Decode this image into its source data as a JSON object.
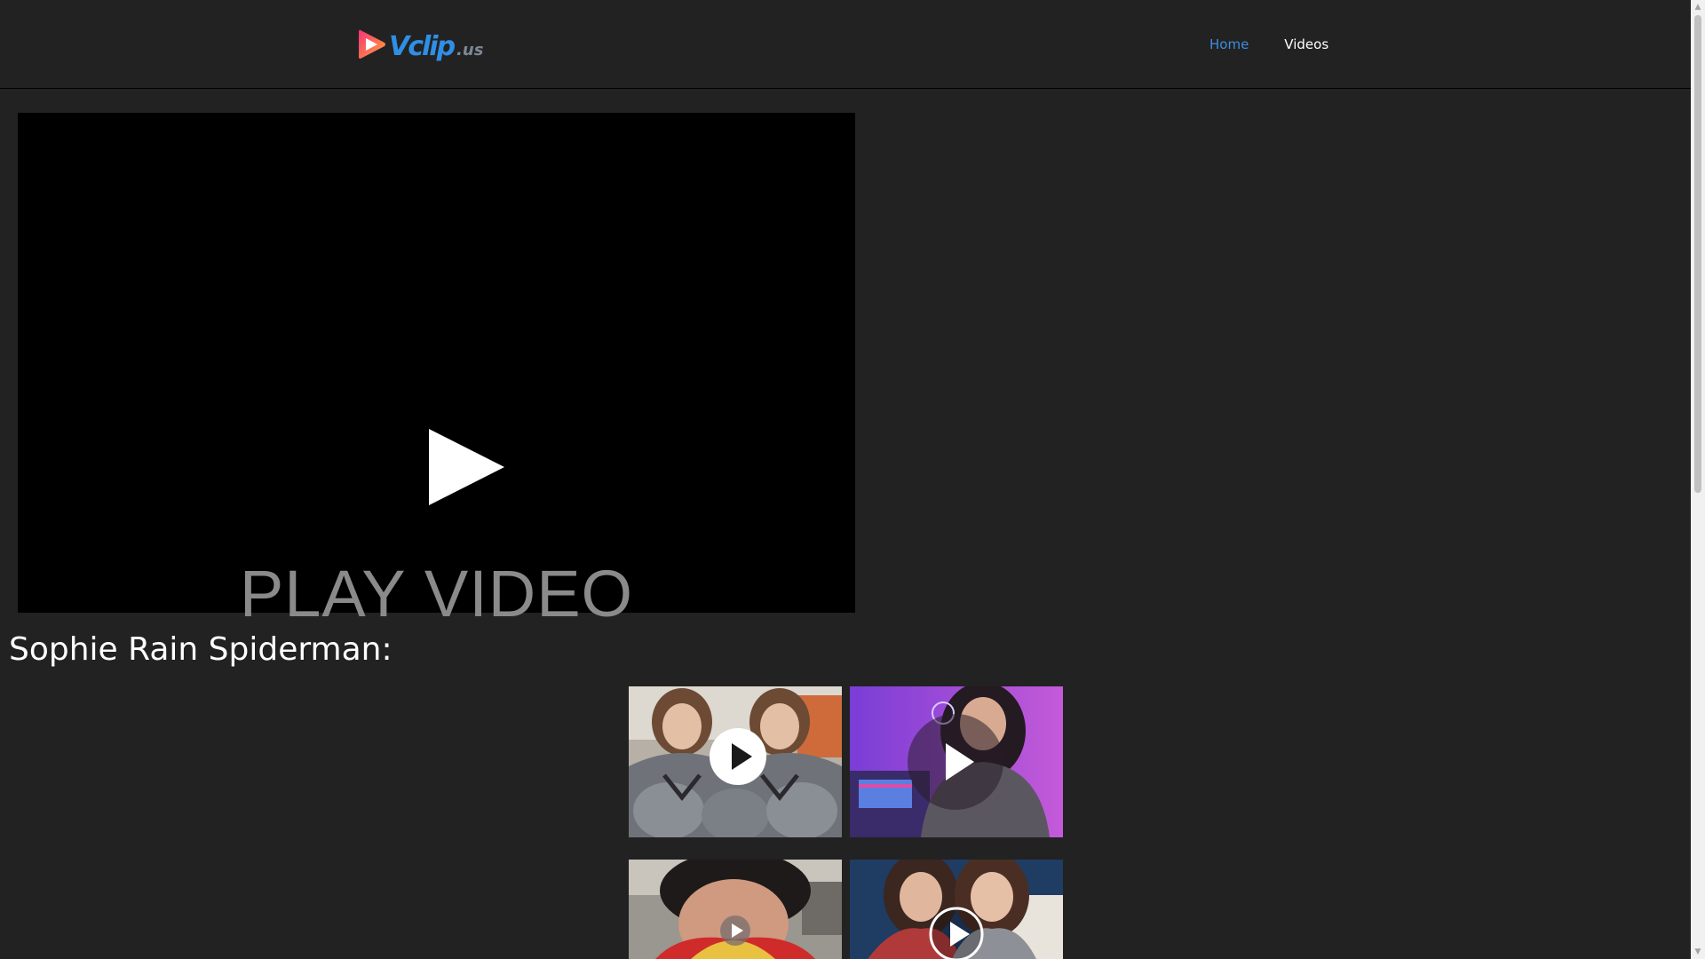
{
  "site": {
    "logo_main": "Vclip",
    "logo_tld": ".us"
  },
  "nav": {
    "items": [
      {
        "label": "Home",
        "active": true
      },
      {
        "label": "Videos",
        "active": false
      }
    ]
  },
  "player": {
    "caption": "PLAY VIDEO",
    "icon": "play-icon"
  },
  "page": {
    "title": "Sophie Rain Spiderman:"
  },
  "thumbnails": [
    {
      "icon": "play-icon"
    },
    {
      "icon": "play-icon"
    },
    {
      "icon": "play-icon"
    },
    {
      "icon": "play-icon"
    }
  ],
  "colors": {
    "background": "#222222",
    "nav_active": "#3d8ee0",
    "nav_link": "#ffffff",
    "logo_blue": "#2f8fe6",
    "logo_gray": "#7c8896",
    "logo_gradient_start": "#f6357a",
    "logo_gradient_end": "#ffa235",
    "player_bg": "#000000",
    "player_caption": "#8a8a8a"
  }
}
